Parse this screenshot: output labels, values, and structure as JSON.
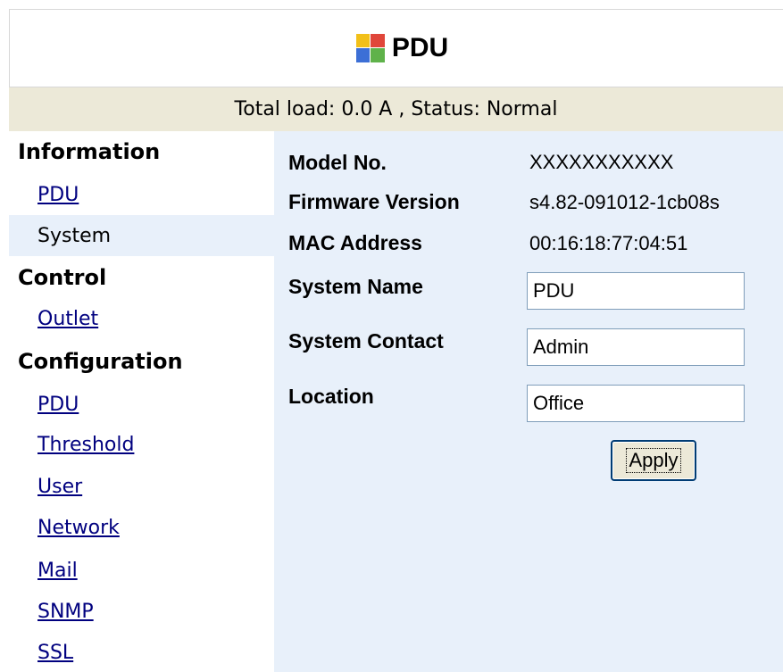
{
  "app": {
    "title": "PDU"
  },
  "status": {
    "text": "Total load: 0.0 A , Status: Normal"
  },
  "sidebar": {
    "information": {
      "title": "Information",
      "items": [
        "PDU",
        "System"
      ]
    },
    "control": {
      "title": "Control",
      "items": [
        "Outlet"
      ]
    },
    "configuration": {
      "title": "Configuration",
      "items": [
        "PDU",
        "Threshold",
        "User",
        "Network",
        "Mail",
        "SNMP",
        "SSL"
      ]
    },
    "selected": "System"
  },
  "system": {
    "model_label": "Model No.",
    "model_value": "XXXXXXXXXXX",
    "firmware_label": "Firmware Version",
    "firmware_value": "s4.82-091012-1cb08s",
    "mac_label": "MAC Address",
    "mac_value": "00:16:18:77:04:51",
    "name_label": "System Name",
    "name_value": "PDU",
    "contact_label": "System Contact",
    "contact_value": "Admin",
    "location_label": "Location",
    "location_value": "Office",
    "apply_label": "Apply"
  },
  "colors": {
    "status_bg": "#ece9d8",
    "content_bg": "#e8f0fa",
    "link": "#00007f"
  }
}
